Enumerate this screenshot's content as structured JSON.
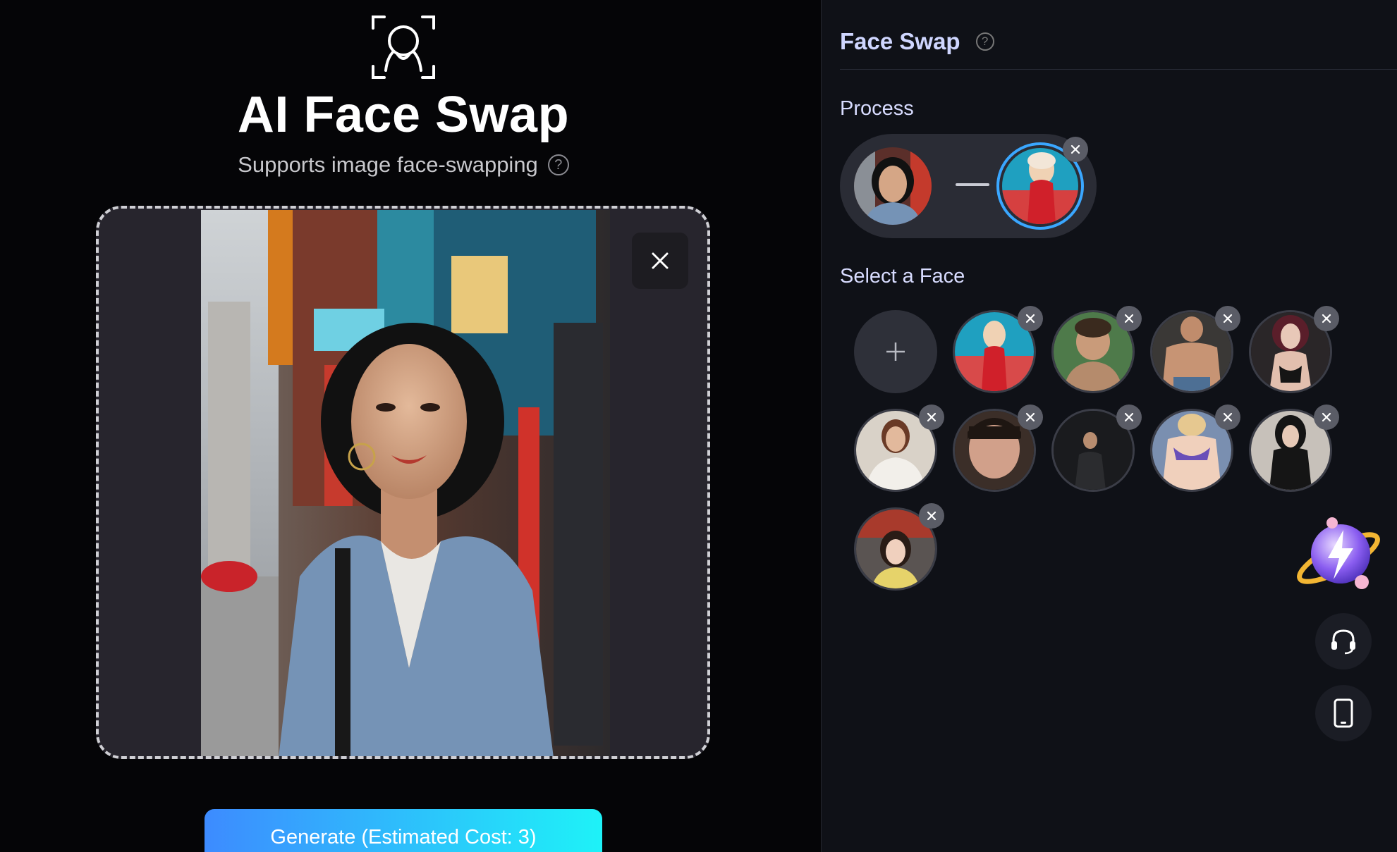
{
  "app": {
    "title": "AI Face Swap",
    "subtitle": "Supports image face-swapping",
    "help_icon": "help-circle-icon",
    "generate_label": "Generate (Estimated Cost: 3)",
    "colors": {
      "accent_start": "#3d8bff",
      "accent_end": "#1ef2f8",
      "panel_title": "#cfd6ff"
    }
  },
  "panel": {
    "title": "Face Swap",
    "process_label": "Process",
    "select_label": "Select a Face"
  },
  "faces": {
    "add_icon": "plus-icon",
    "items": [
      "red-dress",
      "boy-portrait",
      "shirtless-man",
      "dark-cosplay",
      "white-blouse",
      "freckled-woman",
      "dark-tee",
      "bikini-blonde",
      "black-outfit",
      "yellow-top"
    ]
  },
  "floating": {
    "mascot_icon": "lightning-planet-icon",
    "support_icon": "headset-icon",
    "mobile_icon": "smartphone-icon"
  }
}
